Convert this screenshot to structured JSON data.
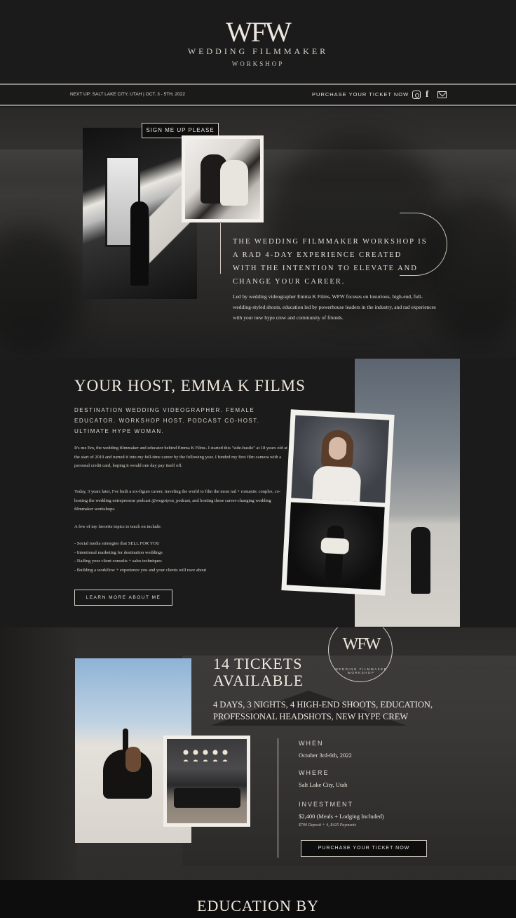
{
  "header": {
    "logo": "WFW",
    "subtitle_line1": "WEDDING FILMMAKER",
    "subtitle_line2": "WORKSHOP"
  },
  "nav": {
    "next_up": "NEXT UP: SALT LAKE CITY, UTAH | OCT. 3 - 5TH, 2022",
    "purchase_link": "PURCHASE YOUR TICKET NOW",
    "social_icons": [
      "instagram-icon",
      "facebook-icon",
      "mail-icon"
    ],
    "facebook_glyph": "f"
  },
  "intro": {
    "signup_button": "SIGN ME UP PLEASE",
    "headline": "THE WEDDING FILMMAKER WORKSHOP IS A RAD 4-DAY EXPERIENCE CREATED WITH THE INTENTION TO ELEVATE AND CHANGE YOUR CAREER.",
    "body": "Led by wedding videographer Emma K Films, WFW focuses on luxurious, high-end, full-wedding-styled shoots, education led by powerhouse leaders in the industry, and rad experiences with your new hype crew and community of friends."
  },
  "host": {
    "title": "YOUR HOST, EMMA K FILMS",
    "subtitle": "DESTINATION WEDDING VIDEOGRAPHER. FEMALE EDUCATOR. WORKSHOP HOST. PODCAST CO-HOST. ULTIMATE HYPE WOMAN.",
    "para1": "It's me Em, the wedding filmmaker and educator behind Emma K Films. I started this \"side-hustle\" at 18 years old at the start of 2019 and turned it into my full-time career by the following year. I funded my first film camera with a personal credit card, hoping it would one day pay itself off.",
    "para2": "Today, 3 years later, I've built a six-figure career, traveling the world to film the most rad + romantic couples, co-hosting the wedding entrepreneur podcast @wegotyou_podcast, and hosting these career-changing wedding filmmaker workshops.",
    "para3": "A few of my favorite topics to teach on include:",
    "topics": [
      "- Social media strategies that SELL FOR YOU",
      "- Intentional marketing for destination weddings",
      "- Nailing your client consults + sales techniques",
      "- Building a workflow + experience you and your clients will rave about"
    ],
    "learn_button": "LEARN MORE ABOUT ME"
  },
  "tickets": {
    "badge_logo": "WFW",
    "badge_ring": "WEDDING FILMMAKER WORKSHOP",
    "count_line1": "14 TICKETS",
    "count_line2": "AVAILABLE",
    "description": "4 DAYS, 3 NIGHTS, 4 HIGH-END SHOOTS, EDUCATION, PROFESSIONAL HEADSHOTS, NEW HYPE CREW",
    "when_label": "WHEN",
    "when_value": "October 3rd-6th, 2022",
    "where_label": "WHERE",
    "where_value": "Salt Lake City, Utah",
    "investment_label": "INVESTMENT",
    "investment_value": "$2,400 (Meals + Lodging Included)",
    "investment_note": "$700 Deposit + 4, $425 Payments",
    "purchase_button": "PURCHASE YOUR TICKET NOW"
  },
  "footer": {
    "title": "EDUCATION BY"
  }
}
